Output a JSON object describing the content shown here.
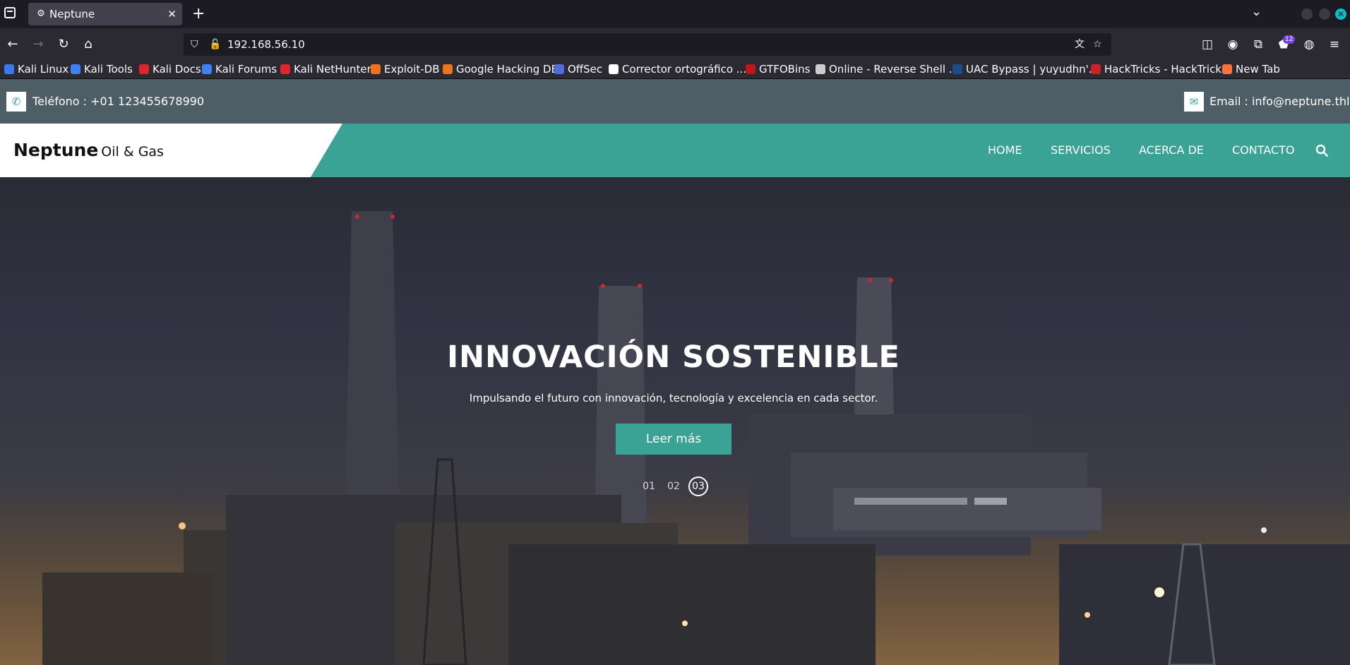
{
  "browser": {
    "tab_title": "Neptune",
    "url": "192.168.56.10",
    "extensions_badge": "12",
    "bookmarks": [
      {
        "label": "Kali Linux",
        "color": "#367bf0"
      },
      {
        "label": "Kali Tools",
        "color": "#3b82f6"
      },
      {
        "label": "Kali Docs",
        "color": "#e0242b"
      },
      {
        "label": "Kali Forums",
        "color": "#3b82f6"
      },
      {
        "label": "Kali NetHunter",
        "color": "#e0242b"
      },
      {
        "label": "Exploit-DB",
        "color": "#f0731c"
      },
      {
        "label": "Google Hacking DB",
        "color": "#f0731c"
      },
      {
        "label": "OffSec",
        "color": "#4f6bde"
      },
      {
        "label": "Corrector ortográfico ...",
        "color": "#ffffff"
      },
      {
        "label": "GTFOBins",
        "color": "#c0151b"
      },
      {
        "label": "Online - Reverse Shell ...",
        "color": "#cccccc"
      },
      {
        "label": "UAC Bypass | yuyudhn'...",
        "color": "#1a4e8a"
      },
      {
        "label": "HackTricks - HackTricks",
        "color": "#d01f2a"
      },
      {
        "label": "New Tab",
        "color": "#ff7139"
      }
    ]
  },
  "topbar": {
    "phone": "Teléfono : +01 123455678990",
    "email": "Email : info@neptune.thl"
  },
  "header": {
    "brand": "Neptune",
    "brand_sub": "Oil & Gas",
    "menu": [
      "HOME",
      "SERVICIOS",
      "ACERCA DE",
      "CONTACTO"
    ]
  },
  "hero": {
    "title": "INNOVACIÓN SOSTENIBLE",
    "subtitle": "Impulsando el futuro con innovación, tecnología y excelencia en cada sector.",
    "button": "Leer más",
    "slides": [
      "01",
      "02",
      "03"
    ],
    "active_slide": "03"
  },
  "colors": {
    "accent": "#3aa396",
    "topbar": "#4d5e66",
    "chrome_dark": "#1c1b22",
    "chrome": "#2b2a33"
  }
}
